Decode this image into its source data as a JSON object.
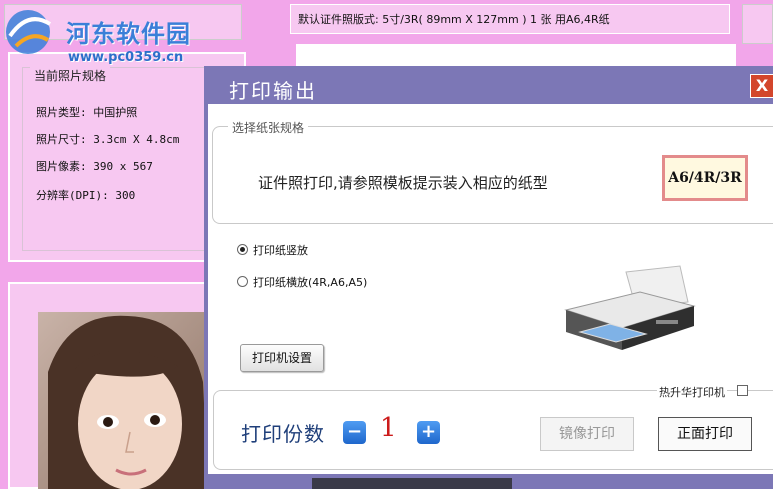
{
  "logo": {
    "text": "河东软件园",
    "url": "www.pc0359.cn"
  },
  "top_strip": {
    "text": "默认证件照版式: 5寸/3R( 89mm X 127mm ) 1 张 用A6,4R纸"
  },
  "photo_info": {
    "title": "当前照片规格",
    "rows": [
      "照片类型: 中国护照",
      "照片尺寸: 3.3cm X 4.8cm",
      "图片像素: 390 x 567",
      "分辨率(DPI): 300"
    ]
  },
  "dialog": {
    "title": "打印输出",
    "close": "X",
    "paper_group_title": "选择纸张规格",
    "paper_hint": "证件照打印,请参照模板提示装入相应的纸型",
    "paper_size": "A6/4R/3R",
    "orientation": {
      "portrait": "打印纸竖放",
      "landscape": "打印纸横放(4R,A6,A5)",
      "selected": "portrait"
    },
    "printer_settings": "打印机设置",
    "thermal_printer": "热升华打印机",
    "copies_label": "打印份数",
    "minus": "−",
    "plus": "+",
    "copies": "1",
    "mirror_print": "镜像打印",
    "front_print": "正面打印"
  },
  "colors": {
    "background": "#f2a6ea",
    "dialog_title_bar": "#7c77b6",
    "close_button": "#d3462c",
    "stepper": "#2a7ae0",
    "copies_value": "#cc1b1b"
  },
  "icons": [
    "logo-icon",
    "printer-icon",
    "minus-icon",
    "plus-icon",
    "close-icon"
  ]
}
